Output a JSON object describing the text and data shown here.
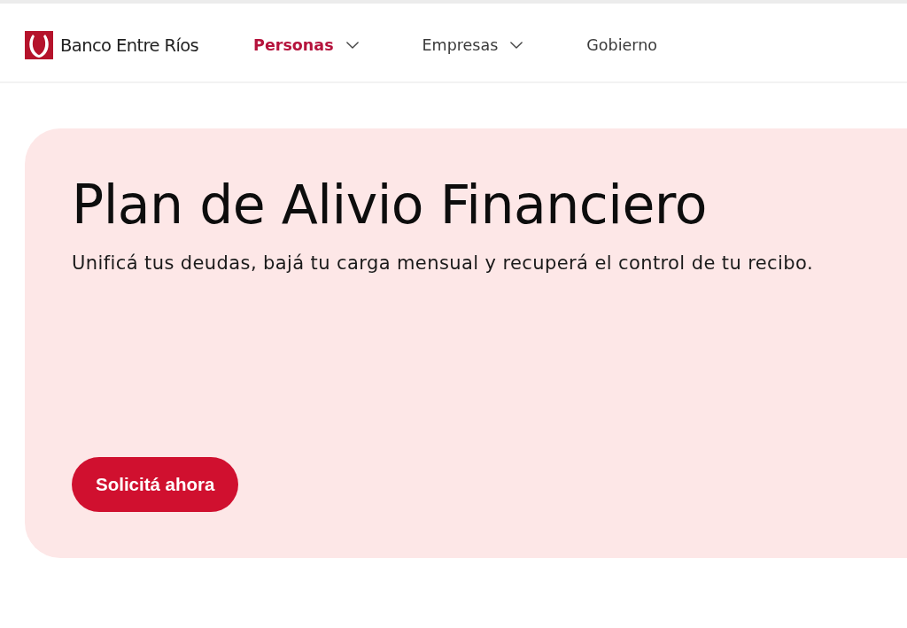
{
  "header": {
    "brand": "Banco Entre Ríos",
    "nav": [
      {
        "label": "Personas",
        "selected": true,
        "dropdown": true
      },
      {
        "label": "Empresas",
        "selected": false,
        "dropdown": true
      },
      {
        "label": "Gobierno",
        "selected": false,
        "dropdown": false
      }
    ]
  },
  "hero": {
    "title": "Plan de Alivio Financiero",
    "subtitle": "Unificá tus deudas, bajá tu carga mensual y recuperá el control de tu recibo.",
    "button": "Solicitá ahora"
  }
}
